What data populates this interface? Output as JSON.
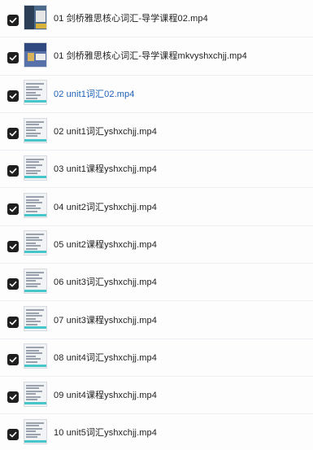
{
  "files": [
    {
      "name": "01 剑桥雅思核心词汇-导学课程02.mp4",
      "checked": true,
      "active": false,
      "thumb": "photo"
    },
    {
      "name": "01 剑桥雅思核心词汇-导学课程mkvyshxchjj.mp4",
      "checked": true,
      "active": false,
      "thumb": "photo2"
    },
    {
      "name": "02 unit1词汇02.mp4",
      "checked": true,
      "active": true,
      "thumb": "doc"
    },
    {
      "name": "02 unit1词汇yshxchjj.mp4",
      "checked": true,
      "active": false,
      "thumb": "doc"
    },
    {
      "name": "03 unit1课程yshxchjj.mp4",
      "checked": true,
      "active": false,
      "thumb": "doc"
    },
    {
      "name": "04 unit2词汇yshxchjj.mp4",
      "checked": true,
      "active": false,
      "thumb": "doc"
    },
    {
      "name": "05 unit2课程yshxchjj.mp4",
      "checked": true,
      "active": false,
      "thumb": "doc"
    },
    {
      "name": "06 unit3词汇yshxchjj.mp4",
      "checked": true,
      "active": false,
      "thumb": "doc"
    },
    {
      "name": "07 unit3课程yshxchjj.mp4",
      "checked": true,
      "active": false,
      "thumb": "doc"
    },
    {
      "name": "08 unit4词汇yshxchjj.mp4",
      "checked": true,
      "active": false,
      "thumb": "doc"
    },
    {
      "name": "09 unit4课程yshxchjj.mp4",
      "checked": true,
      "active": false,
      "thumb": "doc"
    },
    {
      "name": "10 unit5词汇yshxchjj.mp4",
      "checked": true,
      "active": false,
      "thumb": "doc"
    }
  ],
  "colors": {
    "checkbox": "#1f1f1f",
    "active_text": "#1d5fb8",
    "text": "#222222"
  }
}
